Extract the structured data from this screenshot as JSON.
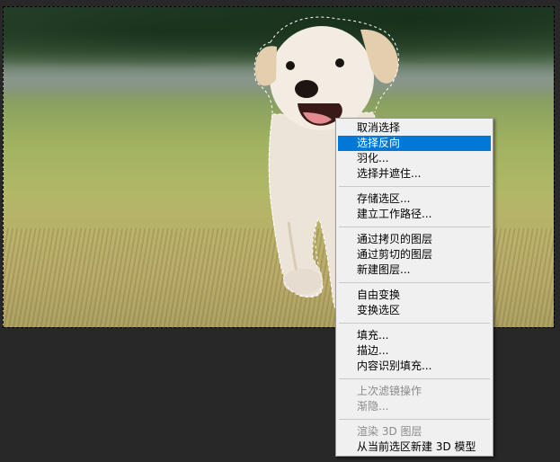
{
  "context_menu": {
    "items": [
      {
        "label": "取消选择",
        "state": "normal"
      },
      {
        "label": "选择反向",
        "state": "highlighted"
      },
      {
        "label": "羽化...",
        "state": "normal"
      },
      {
        "label": "选择并遮住...",
        "state": "normal"
      },
      {
        "label": "存储选区...",
        "state": "normal"
      },
      {
        "label": "建立工作路径...",
        "state": "normal"
      },
      {
        "label": "通过拷贝的图层",
        "state": "normal"
      },
      {
        "label": "通过剪切的图层",
        "state": "normal"
      },
      {
        "label": "新建图层...",
        "state": "normal"
      },
      {
        "label": "自由变换",
        "state": "normal"
      },
      {
        "label": "变换选区",
        "state": "normal"
      },
      {
        "label": "填充...",
        "state": "normal"
      },
      {
        "label": "描边...",
        "state": "normal"
      },
      {
        "label": "内容识别填充...",
        "state": "normal"
      },
      {
        "label": "上次滤镜操作",
        "state": "disabled"
      },
      {
        "label": "渐隐...",
        "state": "disabled"
      },
      {
        "label": "渲染 3D 图层",
        "state": "disabled"
      },
      {
        "label": "从当前选区新建 3D 模型",
        "state": "normal"
      }
    ]
  },
  "colors": {
    "workspace_background": "#282828",
    "menu_background": "#f0f0f0",
    "menu_highlight": "#0078d7",
    "menu_disabled_text": "#8a8a8a"
  }
}
